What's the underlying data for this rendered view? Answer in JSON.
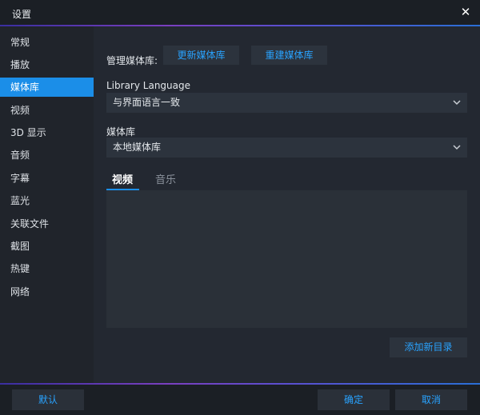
{
  "window": {
    "title": "设置"
  },
  "sidebar": {
    "items": [
      {
        "label": "常规",
        "active": false
      },
      {
        "label": "播放",
        "active": false
      },
      {
        "label": "媒体库",
        "active": true
      },
      {
        "label": "视频",
        "active": false
      },
      {
        "label": "3D 显示",
        "active": false
      },
      {
        "label": "音频",
        "active": false
      },
      {
        "label": "字幕",
        "active": false
      },
      {
        "label": "蓝光",
        "active": false
      },
      {
        "label": "关联文件",
        "active": false
      },
      {
        "label": "截图",
        "active": false
      },
      {
        "label": "热键",
        "active": false
      },
      {
        "label": "网络",
        "active": false
      }
    ]
  },
  "library": {
    "manage_label": "管理媒体库:",
    "update_button": "更新媒体库",
    "rebuild_button": "重建媒体库",
    "language_label": "Library Language",
    "language_value": "与界面语言一致",
    "media_label": "媒体库",
    "media_value": "本地媒体库",
    "tabs": [
      {
        "label": "视频",
        "active": true
      },
      {
        "label": "音乐",
        "active": false
      }
    ],
    "add_dir_button": "添加新目录"
  },
  "footer": {
    "default_button": "默认",
    "ok_button": "确定",
    "cancel_button": "取消"
  },
  "colors": {
    "accent": "#1b8ee8",
    "link_text": "#29a3ff"
  }
}
